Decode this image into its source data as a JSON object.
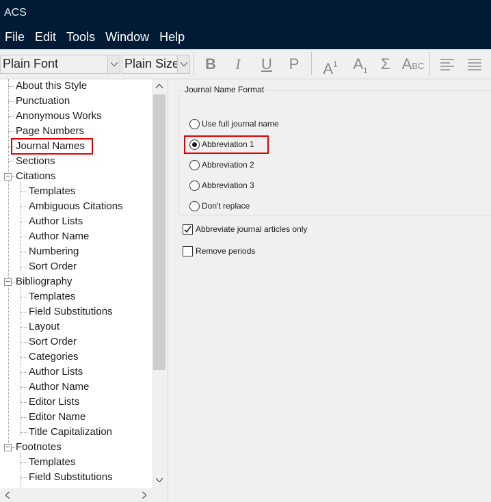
{
  "window": {
    "title": "ACS"
  },
  "menu": [
    "File",
    "Edit",
    "Tools",
    "Window",
    "Help"
  ],
  "toolbar": {
    "font_value": "Plain Font",
    "size_value": "Plain Size",
    "buttons": [
      "bold-icon",
      "italic-icon",
      "underline-icon",
      "plain-icon",
      "superscript-icon",
      "subscript-icon",
      "symbol-icon",
      "small-caps-icon",
      "align-left-icon",
      "justify-icon"
    ]
  },
  "tree": {
    "selected": "Journal Names",
    "items": [
      "About this Style",
      "Punctuation",
      "Anonymous Works",
      "Page Numbers",
      "Journal Names",
      "Sections",
      "Citations",
      "Templates",
      "Ambiguous Citations",
      "Author Lists",
      "Author Name",
      "Numbering",
      "Sort Order",
      "Bibliography",
      "Templates",
      "Field Substitutions",
      "Layout",
      "Sort Order",
      "Categories",
      "Author Lists",
      "Author Name",
      "Editor Lists",
      "Editor Name",
      "Title Capitalization",
      "Footnotes",
      "Templates",
      "Field Substitutions"
    ]
  },
  "journal_format": {
    "group_label": "Journal Name Format",
    "options": [
      "Use full journal name",
      "Abbreviation 1",
      "Abbreviation 2",
      "Abbreviation 3",
      "Don't replace"
    ],
    "selected": "Abbreviation 1"
  },
  "checkboxes": [
    {
      "label": "Abbreviate journal articles only",
      "checked": true
    },
    {
      "label": "Remove periods",
      "checked": false
    }
  ],
  "colors": {
    "titlebar": "#011a35",
    "highlight": "#e00000"
  }
}
